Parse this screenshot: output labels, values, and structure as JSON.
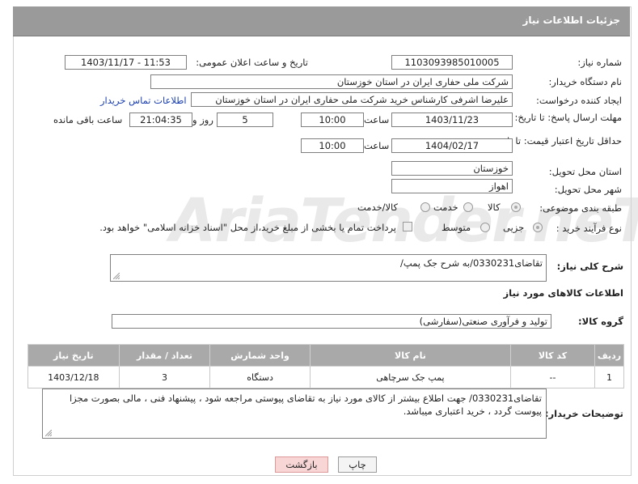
{
  "window_title": "جزئیات اطلاعات نیاز",
  "watermark": "AriaTender.neT",
  "fields": {
    "need_number_label": "شماره نیاز:",
    "need_number": "1103093985010005",
    "announce_label": "تاریخ و ساعت اعلان عمومی:",
    "announce_value": "1403/11/17 - 11:53",
    "buyer_org_label": "نام دستگاه خریدار:",
    "buyer_org": "شرکت ملی حفاری ایران در استان خوزستان",
    "creator_label": "ایجاد کننده درخواست:",
    "creator": "علیرضا اشرفی کارشناس خرید شرکت ملی حفاری ایران در استان خوزستان",
    "contact_link": "اطلاعات تماس خریدار",
    "reply_deadline_label": "مهلت ارسال پاسخ: تا تاریخ:",
    "reply_date": "1403/11/23",
    "time_label": "ساعت",
    "reply_time": "10:00",
    "days": "5",
    "days_label": "روز و",
    "remaining": "21:04:35",
    "remaining_label": "ساعت باقی مانده",
    "price_deadline_label": "حداقل تاریخ اعتبار قیمت: تا تاریخ:",
    "price_date": "1404/02/17",
    "price_time": "10:00",
    "province_label": "استان محل تحویل:",
    "province": "خوزستان",
    "city_label": "شهر محل تحویل:",
    "city": "اهواز",
    "category_label": "طبقه بندی موضوعی:",
    "category_options": [
      "کالا",
      "خدمت",
      "کالا/خدمت"
    ],
    "process_label": "نوع فرآیند خرید :",
    "process_options": [
      "جزیی",
      "متوسط"
    ],
    "payment_note": "پرداخت تمام یا بخشی از مبلغ خرید،از محل \"اسناد خزانه اسلامی\" خواهد بود."
  },
  "description": {
    "label": "شرح کلی نیاز:",
    "value": "تقاضای0330231/به شرح جک پمپ/"
  },
  "goods_section_title": "اطلاعات کالاهای مورد نیاز",
  "goods_group": {
    "label": "گروه کالا:",
    "value": "تولید و فرآوری صنعتی(سفارشی)"
  },
  "table": {
    "headers": [
      "ردیف",
      "کد کالا",
      "نام کالا",
      "واحد شمارش",
      "تعداد / مقدار",
      "تاریخ نیاز"
    ],
    "rows": [
      [
        "1",
        "--",
        "پمپ جک سرچاهی",
        "دستگاه",
        "3",
        "1403/12/18"
      ]
    ]
  },
  "buyer_notes": {
    "label": "توضیحات خریدار:",
    "value": "تقاضای0330231/ جهت اطلاع بیشتر از کالای مورد نیاز به تقاضای پیوستی مراجعه شود ، پیشنهاد فنی ، مالی بصورت مجزا پیوست گردد ، خرید اعتباری میباشد."
  },
  "buttons": {
    "print": "چاپ",
    "back": "بازگشت"
  }
}
